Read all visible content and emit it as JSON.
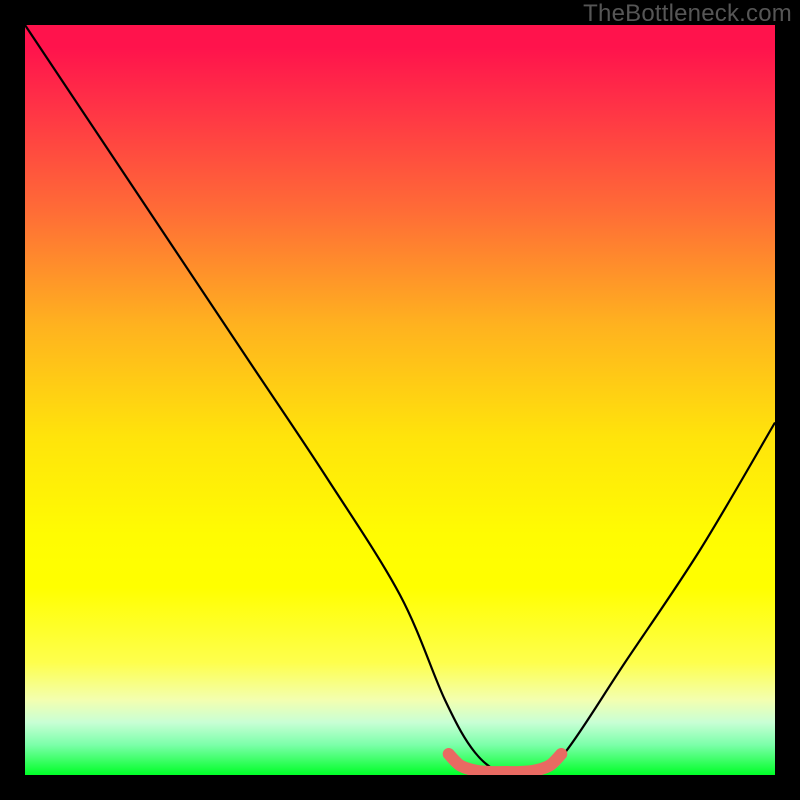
{
  "watermark": "TheBottleneck.com",
  "chart_data": {
    "type": "line",
    "title": "",
    "xlabel": "",
    "ylabel": "",
    "xlim": [
      0,
      100
    ],
    "ylim": [
      0,
      100
    ],
    "series": [
      {
        "name": "bottleneck-curve",
        "x": [
          0,
          10,
          20,
          30,
          40,
          50,
          56,
          60,
          64,
          68,
          72,
          80,
          90,
          100
        ],
        "y": [
          100,
          85,
          70,
          55,
          40,
          24,
          10,
          3,
          0,
          0,
          3,
          15,
          30,
          47
        ],
        "stroke": "#000000",
        "stroke_width": 2
      },
      {
        "name": "optimal-zone-marker",
        "x": [
          56.5,
          58,
          60,
          62,
          64,
          66,
          68,
          70,
          71.5
        ],
        "y": [
          2.8,
          1.3,
          0.6,
          0.4,
          0.4,
          0.4,
          0.6,
          1.3,
          2.8
        ],
        "stroke": "#e96a62",
        "stroke_width": 10,
        "linecap": "round"
      }
    ],
    "gradient_stops": [
      {
        "pos": 0.0,
        "color": "#ff134c"
      },
      {
        "pos": 0.3,
        "color": "#ff8a2c"
      },
      {
        "pos": 0.6,
        "color": "#fff205"
      },
      {
        "pos": 0.9,
        "color": "#d7ffb3"
      },
      {
        "pos": 1.0,
        "color": "#00ff27"
      }
    ]
  }
}
